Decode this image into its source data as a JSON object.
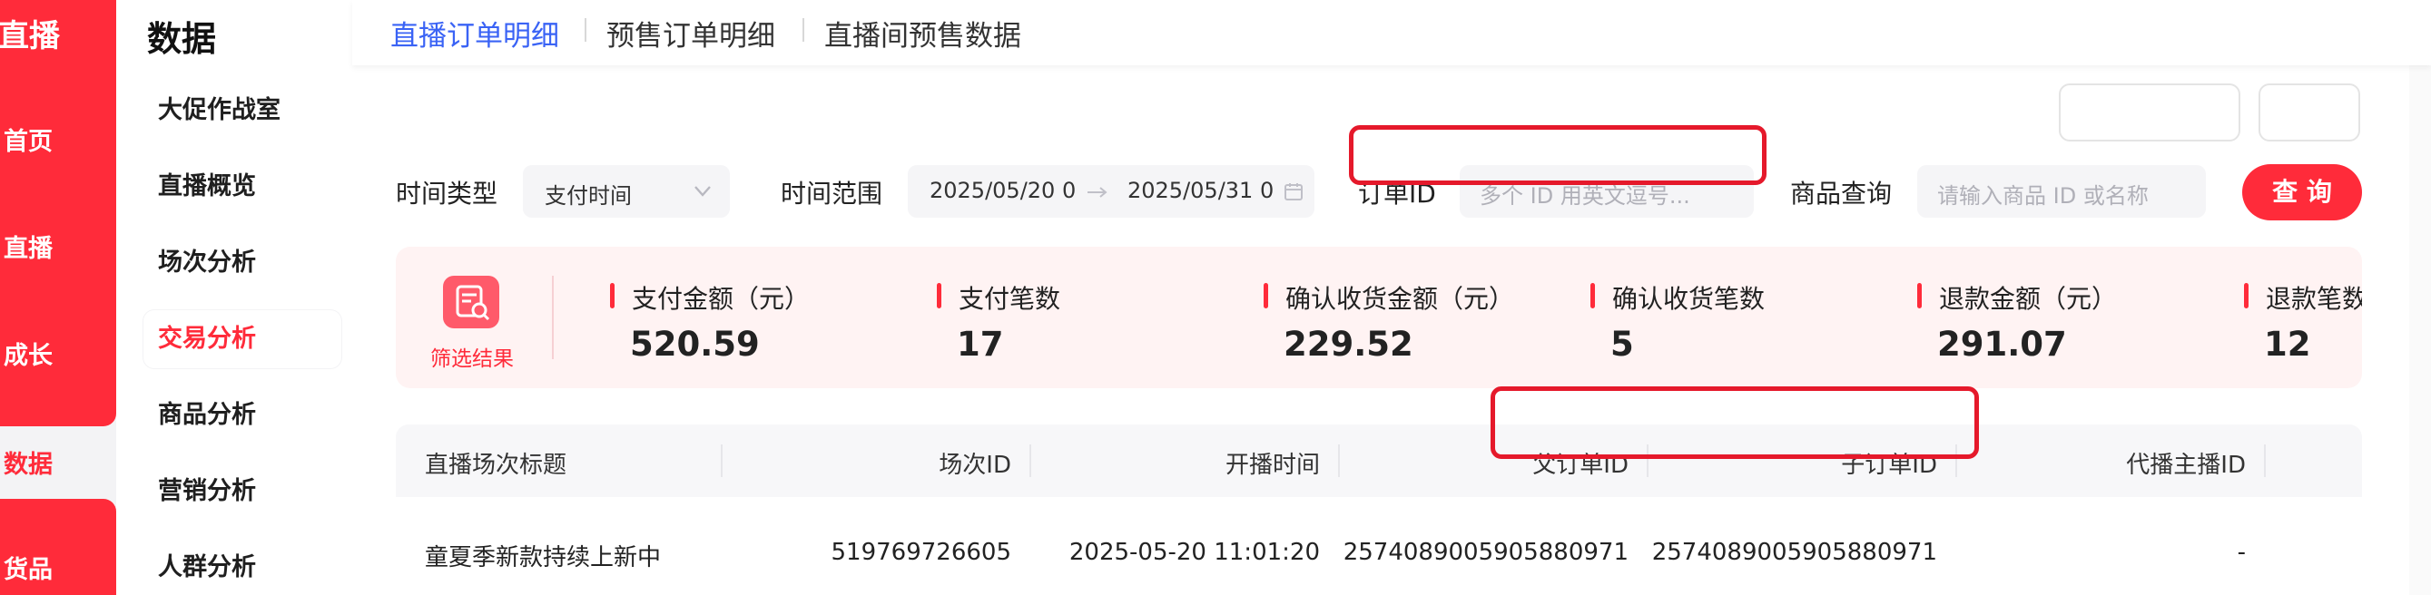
{
  "rail": {
    "brand": "宝直播",
    "items": [
      {
        "label": "首页"
      },
      {
        "label": "直播"
      },
      {
        "label": "成长"
      },
      {
        "label": "数据"
      },
      {
        "label": "货品"
      }
    ]
  },
  "subnav": {
    "title": "数据",
    "items": [
      {
        "label": "大促作战室"
      },
      {
        "label": "直播概览"
      },
      {
        "label": "场次分析"
      },
      {
        "label": "交易分析"
      },
      {
        "label": "商品分析"
      },
      {
        "label": "营销分析"
      },
      {
        "label": "人群分析"
      }
    ]
  },
  "tabs": [
    {
      "label": "直播订单明细"
    },
    {
      "label": "预售订单明细"
    },
    {
      "label": "直播间预售数据"
    }
  ],
  "filters": {
    "time_type_label": "时间类型",
    "time_type_value": "支付时间",
    "range_label": "时间范围",
    "range_start": "2025/05/20 0",
    "range_end": "2025/05/31 0",
    "order_id_label": "订单ID",
    "order_id_placeholder": "多个 ID 用英文逗号...",
    "product_label": "商品查询",
    "product_placeholder": "请输入商品 ID 或名称",
    "query_label": "查 询"
  },
  "summary": {
    "icon_label": "筛选结果",
    "metrics": [
      {
        "label": "支付金额（元）",
        "value": "520.59"
      },
      {
        "label": "支付笔数",
        "value": "17"
      },
      {
        "label": "确认收货金额（元）",
        "value": "229.52"
      },
      {
        "label": "确认收货笔数",
        "value": "5"
      },
      {
        "label": "退款金额（元）",
        "value": "291.07"
      },
      {
        "label": "退款笔数",
        "value": "12"
      }
    ]
  },
  "table": {
    "columns": [
      "直播场次标题",
      "场次ID",
      "开播时间",
      "父订单ID",
      "子订单ID",
      "代播主播ID"
    ],
    "rows": [
      [
        "童夏季新款持续上新中",
        "519769726605",
        "2025-05-20 11:01:20",
        "2574089005905880971",
        "2574089005905880971",
        "-"
      ]
    ]
  },
  "colors": {
    "brand_red": "#ff2b3a",
    "tab_active_blue": "#3a63f5",
    "annotation_red": "#e5192b"
  }
}
